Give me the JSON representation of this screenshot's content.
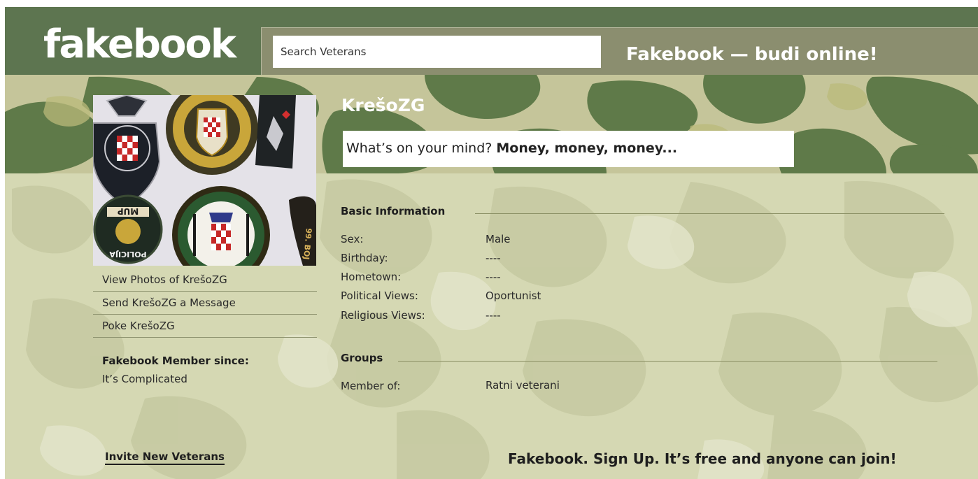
{
  "header": {
    "logo": "fakebook",
    "search_placeholder": "Search Veterans",
    "tagline": "Fakebook — budi online!"
  },
  "profile": {
    "name": "KrešoZG",
    "status_prompt": "What’s on your mind?",
    "status_text": "Money, money, money...",
    "photo_patch_text": [
      "MUP",
      "POLICIJA",
      "99. BOJ"
    ]
  },
  "sidebar": {
    "links": [
      "View Photos of KrešoZG",
      "Send KrešoZG a Message",
      "Poke KrešoZG"
    ],
    "member_since_label": "Fakebook Member since:",
    "member_since_value": "It’s Complicated"
  },
  "basic_info": {
    "header": "Basic Information",
    "rows": [
      {
        "label": "Sex:",
        "value": "Male"
      },
      {
        "label": "Birthday:",
        "value": "----"
      },
      {
        "label": "Hometown:",
        "value": "----"
      },
      {
        "label": "Political Views:",
        "value": "Oportunist"
      },
      {
        "label": "Religious Views:",
        "value": "----"
      }
    ]
  },
  "groups": {
    "header": "Groups",
    "rows": [
      {
        "label": "Member of:",
        "value": "Ratni veterani"
      }
    ]
  },
  "footer": {
    "invite": "Invite New Veterans",
    "signup": "Fakebook. Sign Up. It’s free and anyone can join!"
  },
  "colors": {
    "topbar": "#5d7550",
    "search_strip": "#8b8e6f",
    "camo_dark": "#5f7a49",
    "camo_light": "#d6d8b4"
  }
}
